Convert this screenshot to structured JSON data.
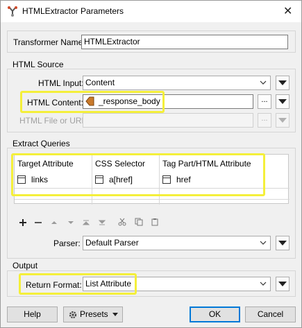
{
  "window": {
    "title": "HTMLExtractor Parameters",
    "close_glyph": "✕"
  },
  "transformer": {
    "label": "Transformer Name:",
    "value": "HTMLExtractor"
  },
  "html_source": {
    "group_title": "HTML Source",
    "html_input_label": "HTML Input:",
    "html_input_value": "Content",
    "html_content_label": "HTML Content:",
    "html_content_value": "_response_body",
    "html_file_label": "HTML File or URL:",
    "html_file_value": "",
    "ellipsis": "..."
  },
  "extract_queries": {
    "group_title": "Extract Queries",
    "columns": [
      "Target Attribute",
      "CSS Selector",
      "Tag Part/HTML Attribute"
    ],
    "rows": [
      [
        "links",
        "a[href]",
        "href"
      ]
    ],
    "toolbar_icons": [
      "add-icon",
      "remove-icon",
      "move-up-icon",
      "move-down-icon",
      "move-top-icon",
      "move-bottom-icon",
      "cut-icon",
      "copy-icon",
      "paste-icon"
    ]
  },
  "parser": {
    "label": "Parser:",
    "value": "Default Parser"
  },
  "output": {
    "group_title": "Output",
    "return_format_label": "Return Format:",
    "return_format_value": "List Attribute"
  },
  "buttons": {
    "help": "Help",
    "presets": "Presets",
    "ok": "OK",
    "cancel": "Cancel"
  },
  "colors": {
    "highlight": "#f4ef3a",
    "ok_border": "#0078d7",
    "attr_icon": "#c97a2b"
  }
}
